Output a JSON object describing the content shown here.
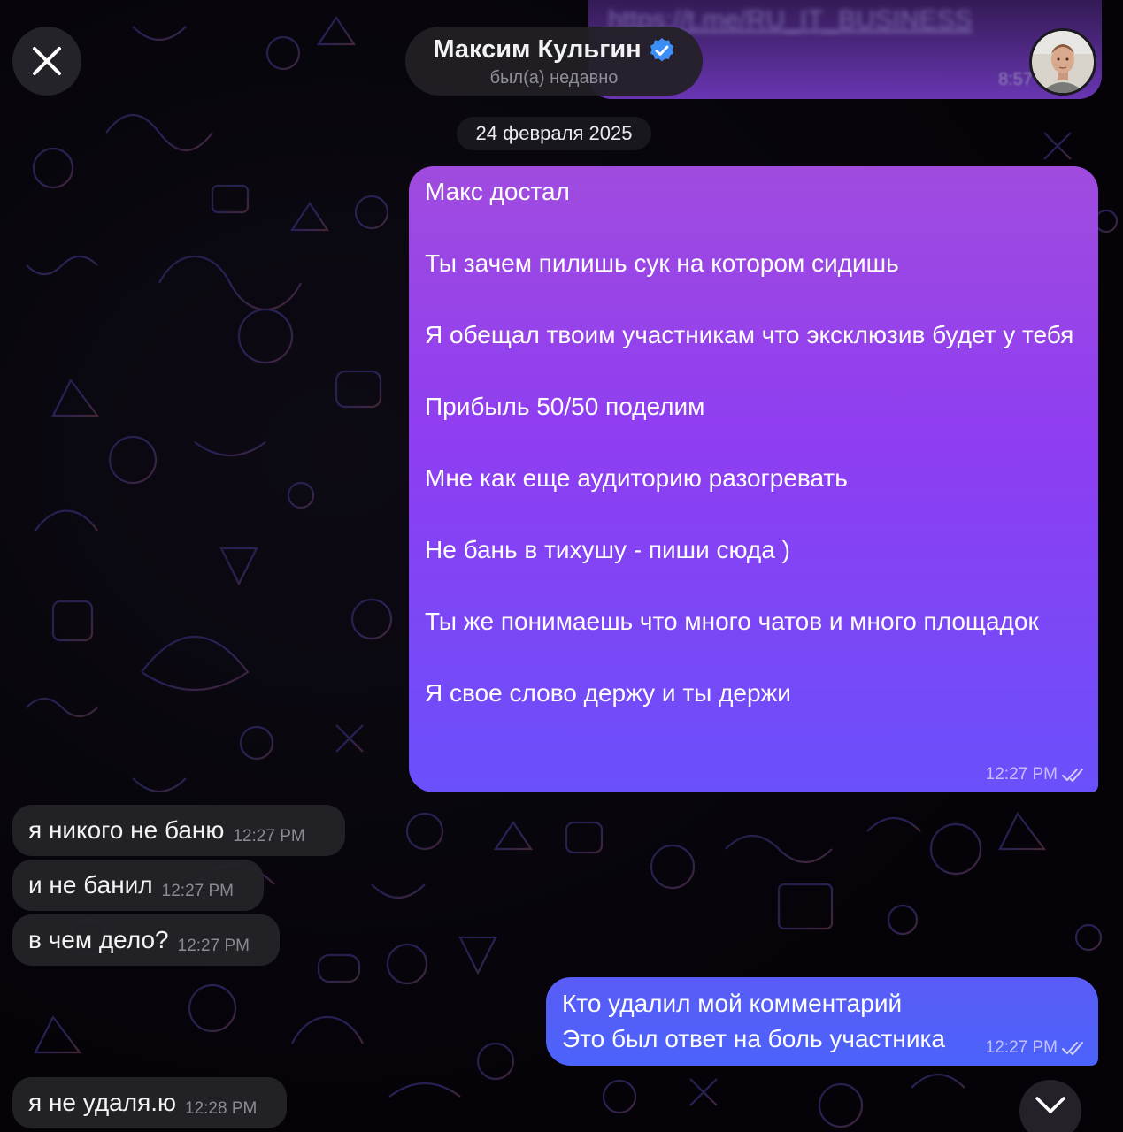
{
  "header": {
    "contact_name": "Максим Кульгин",
    "status": "был(а) недавно",
    "verified_icon": "verified-badge-icon",
    "close_icon": "close-icon"
  },
  "background_message": {
    "link_text": "https://t.me/RU_IT_BUSINESS",
    "time": "8:57"
  },
  "date_separator": "24 февраля 2025",
  "messages": [
    {
      "direction": "out",
      "text": "Макс достал\n\nТы зачем пилишь сук на котором сидишь\n\nЯ обещал твоим участникам что эксклюзив будет у тебя\n\nПрибыль 50/50 поделим\n\nМне как еще аудиторию разогревать\n\nНе бань в тихушу - пиши сюда )\n\nТы же понимаешь что много чатов и много площадок\n\nЯ свое слово держу и ты держи",
      "time": "12:27 PM",
      "status": "read"
    },
    {
      "direction": "in",
      "text": "я никого не баню",
      "time": "12:27 PM"
    },
    {
      "direction": "in",
      "text": "и не банил",
      "time": "12:27 PM"
    },
    {
      "direction": "in",
      "text": "в чем дело?",
      "time": "12:27 PM"
    },
    {
      "direction": "out",
      "lines": [
        "Кто удалил мой комментарий",
        "Это был ответ на боль участника"
      ],
      "time": "12:27 PM",
      "status": "read"
    },
    {
      "direction": "in",
      "text": "я не удаля.ю",
      "time": "12:28 PM"
    }
  ],
  "colors": {
    "bubble_gradient_top": "#a04bde",
    "bubble_gradient_bottom": "#6a50fb",
    "blue_bubble": "#5060f9",
    "incoming_bubble": "#242428",
    "verified_blue": "#3a8ef6"
  },
  "controls": {
    "scroll_down_icon": "chevron-down-icon"
  }
}
